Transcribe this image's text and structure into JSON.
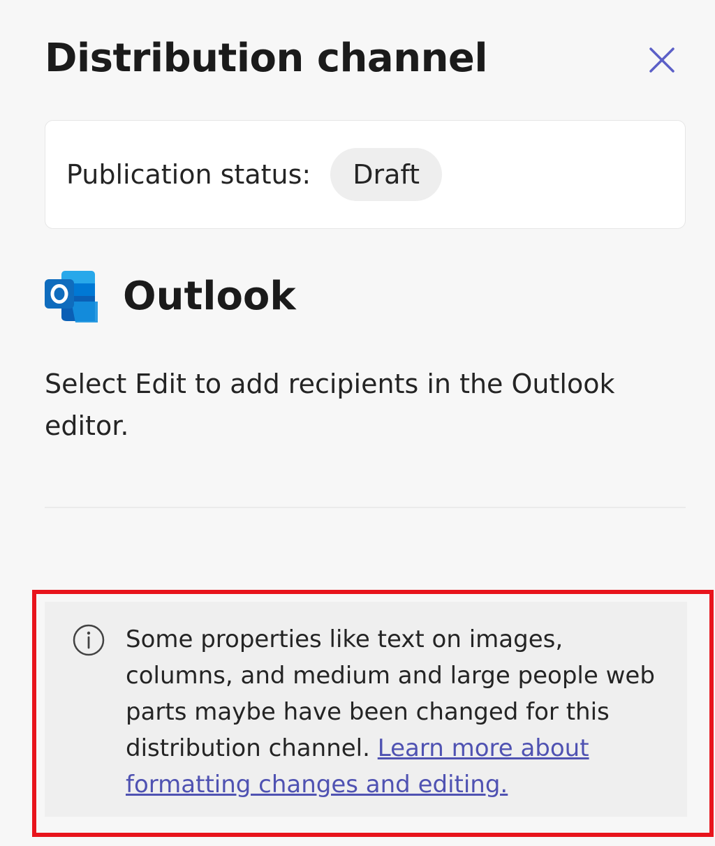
{
  "panel": {
    "title": "Distribution channel",
    "close_icon": "close-icon"
  },
  "publication": {
    "label": "Publication status:",
    "status": "Draft"
  },
  "channel": {
    "icon": "outlook-logo-icon",
    "name": "Outlook",
    "description": "Select Edit to add recipients in the Outlook editor."
  },
  "notice": {
    "icon": "info-icon",
    "text": "Some properties like text on images, columns, and medium and large people web parts maybe have been changed for this distribution channel.",
    "link_text": "Learn more about formatting changes and editing."
  },
  "colors": {
    "accent": "#5b5fc7",
    "link": "#4f52b2",
    "highlight_border": "#e8141c",
    "outlook_blue": "#0f6cbd"
  }
}
